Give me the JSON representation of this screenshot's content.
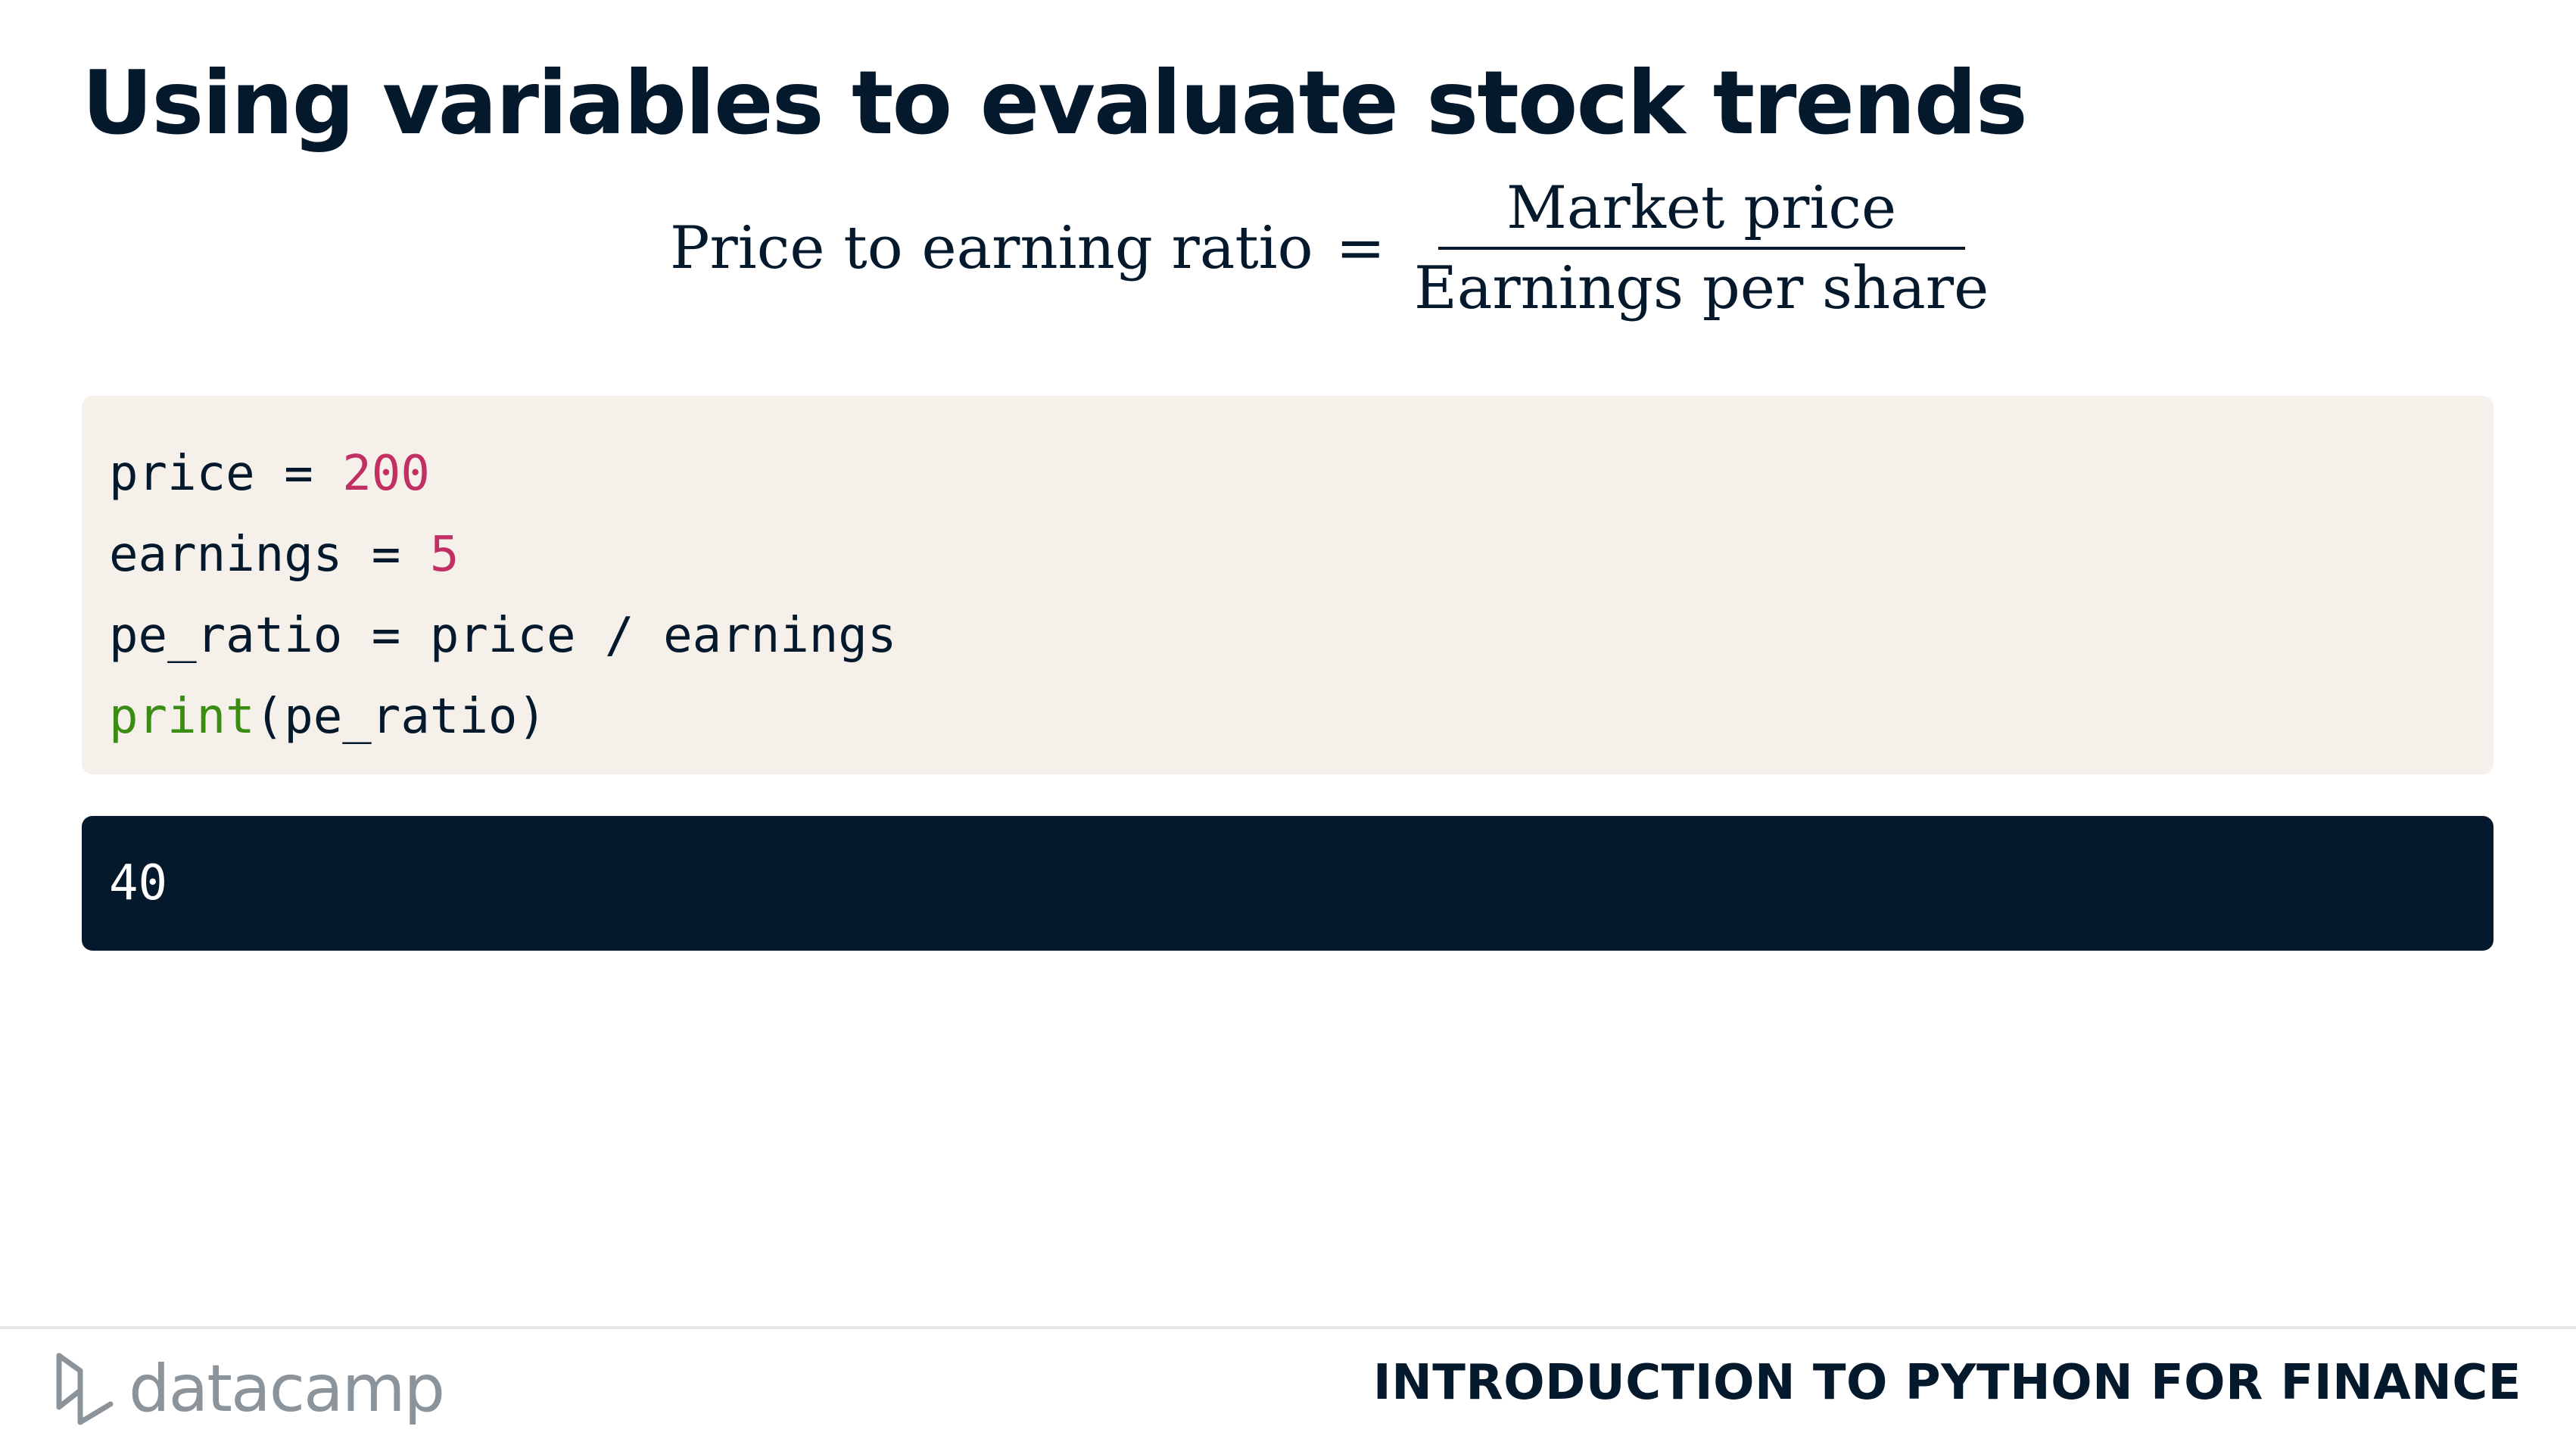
{
  "slide": {
    "title": "Using variables to evaluate stock trends"
  },
  "formula": {
    "lhs": "Price to earning ratio",
    "equals": "=",
    "numerator": "Market price",
    "denominator": "Earnings per share"
  },
  "code": {
    "lines": [
      [
        {
          "text": "price = ",
          "kind": "plain"
        },
        {
          "text": "200",
          "kind": "number"
        }
      ],
      [
        {
          "text": "earnings = ",
          "kind": "plain"
        },
        {
          "text": "5",
          "kind": "number"
        }
      ],
      [
        {
          "text": "pe_ratio = price / earnings",
          "kind": "plain"
        }
      ],
      [
        {
          "text": "print",
          "kind": "builtin"
        },
        {
          "text": "(pe_ratio)",
          "kind": "plain"
        }
      ]
    ]
  },
  "output": {
    "text": "40"
  },
  "footer": {
    "logo_text": "datacamp",
    "logo_icon": "datacamp-logo-icon",
    "course_title": "INTRODUCTION TO PYTHON FOR FINANCE"
  },
  "colors": {
    "navy": "#05192d",
    "code_bg": "#f5f1ea",
    "number": "#c12f63",
    "builtin": "#3a8c13",
    "logo_gray": "#8b939b"
  }
}
